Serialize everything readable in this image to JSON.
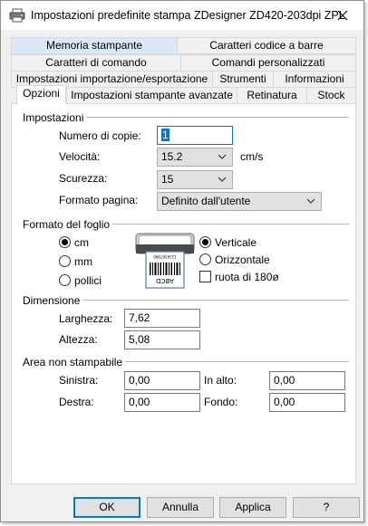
{
  "window": {
    "title": "Impostazioni predefinite stampa ZDesigner ZD420-203dpi ZPL",
    "close_glyph": "✕"
  },
  "tabs": {
    "row1": [
      "Memoria stampante",
      "Caratteri codice a barre"
    ],
    "row2": [
      "Caratteri di comando",
      "Comandi personalizzati"
    ],
    "row3": [
      "Impostazioni importazione/esportazione",
      "Strumenti",
      "Informazioni"
    ],
    "row4": [
      "Opzioni",
      "Impostazioni stampante avanzate",
      "Retinatura",
      "Stock"
    ]
  },
  "settings": {
    "group_label": "Impostazioni",
    "copies_label": "Numero di copie:",
    "copies_value": "1",
    "speed_label": "Velocità:",
    "speed_value": "15.2",
    "speed_unit": "cm/s",
    "darkness_label": "Scurezza:",
    "darkness_value": "15",
    "page_format_label": "Formato pagina:",
    "page_format_value": "Definito dall'utente"
  },
  "paper_format": {
    "group_label": "Formato del foglio",
    "units": [
      "cm",
      "mm",
      "pollici"
    ],
    "selected_unit": "cm",
    "orientation": [
      "Verticale",
      "Orizzontale"
    ],
    "selected_orientation": "Verticale",
    "rotate_label": "ruota di 180ø",
    "rotate_checked": false,
    "label_text": "ABCD",
    "label_small_text": "1234567890"
  },
  "dimensions": {
    "group_label": "Dimensione",
    "width_label": "Larghezza:",
    "width_value": "7,62",
    "height_label": "Altezza:",
    "height_value": "5,08"
  },
  "non_printable": {
    "group_label": "Area non stampabile",
    "left_label": "Sinistra:",
    "left_value": "0,00",
    "top_label": "In alto:",
    "top_value": "0,00",
    "right_label": "Destra:",
    "right_value": "0,00",
    "bottom_label": "Fondo:",
    "bottom_value": "0,00"
  },
  "buttons": {
    "ok": "OK",
    "cancel": "Annulla",
    "apply": "Applica",
    "help": "?"
  },
  "colors": {
    "accent": "#0078d7",
    "tab_highlight": "#d9e9f7",
    "dialog_bg": "#f0f0f0"
  }
}
